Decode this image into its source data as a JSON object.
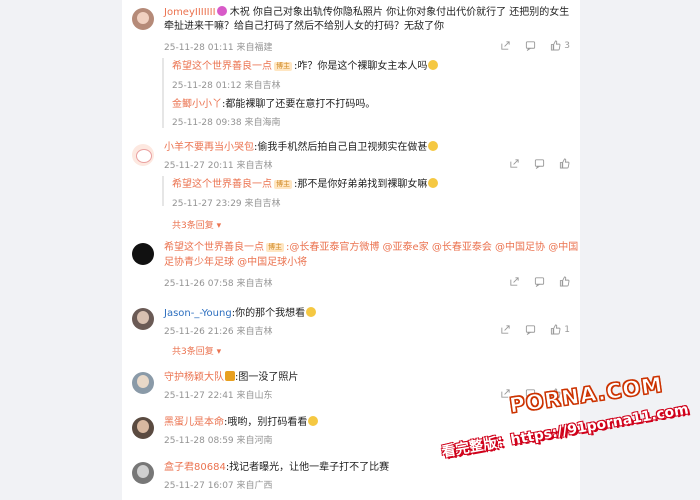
{
  "comments": [
    {
      "name": "JomeyIIIIIII",
      "suffix": " 木祝",
      "text1": "你自己对象出轨传你隐私照片 你让你对象付出代价就行了 还把别的女生",
      "text2": "牵扯进来干嘛？给自己打码了然后不给别人女的打码？无敌了你",
      "time": "25-11-28 01:11",
      "location": "来自福建",
      "likes": "3",
      "replies": [
        {
          "name": "希望这个世界善良一点",
          "badge": "博主",
          "text": ":咋？你是这个裸聊女主本人吗",
          "time": "25-11-28 01:12",
          "location": "来自吉林"
        },
        {
          "name": "金鲫小小丫",
          "text": ":都能裸聊了还要在意打不打码吗。",
          "time": "25-11-28 09:38",
          "location": "来自海南"
        }
      ]
    },
    {
      "name": "小羊不要再当小哭包",
      "text1": ":偷我手机然后拍自己自卫视频实在做甚",
      "time": "25-11-27 20:11",
      "location": "来自吉林",
      "replies": [
        {
          "name": "希望这个世界善良一点",
          "badge": "博主",
          "text": ":那不是你好弟弟找到裸聊女嘛",
          "time": "25-11-27 23:29",
          "location": "来自吉林"
        }
      ],
      "more": "共3条回复"
    },
    {
      "name": "希望这个世界善良一点",
      "badge": "博主",
      "text1": ":@长春亚泰官方微博 @亚泰e家 @长春亚泰会 @中国足协 @中国",
      "text2": "足协青少年足球 @中国足球小将",
      "time": "25-11-26 07:58",
      "location": "来自吉林"
    },
    {
      "name": "Jason-_-Young",
      "text1": ":你的那个我想看",
      "time": "25-11-26 21:26",
      "location": "来自吉林",
      "likes": "1",
      "more": "共3条回复"
    },
    {
      "name": "守护杨颖大队",
      "text1": ":图一没了照片",
      "time": "25-11-27 22:41",
      "location": "来自山东",
      "likes": "1"
    },
    {
      "name": "黑蛋儿是本命",
      "text1": ":哦哟，别打码看看",
      "time": "25-11-28 08:59",
      "location": "来自河南"
    },
    {
      "name": "盒子君80684",
      "text1": ":找记者曝光，让他一辈子打不了比赛",
      "time": "25-11-27 16:07",
      "location": "来自广西"
    }
  ],
  "watermark": {
    "site": "PORNA.COM",
    "url": "看完整版：https://91porna11.com"
  }
}
